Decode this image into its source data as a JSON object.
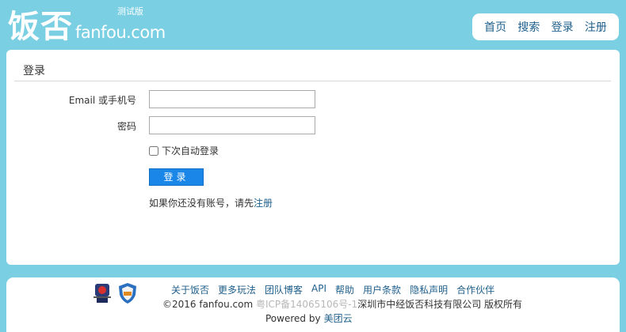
{
  "header": {
    "logo_cn": "饭否",
    "logo_en": "fanfou.com",
    "logo_beta": "测试版",
    "nav": [
      "首页",
      "搜索",
      "登录",
      "注册"
    ]
  },
  "login": {
    "title": "登录",
    "email_label": "Email 或手机号",
    "email_value": "",
    "password_label": "密码",
    "password_value": "",
    "remember_label": "下次自动登录",
    "remember_checked": false,
    "submit_label": "登录",
    "register_prefix": "如果你还没有账号，请先",
    "register_link": "注册"
  },
  "footer": {
    "links": [
      "关于饭否",
      "更多玩法",
      "团队博客",
      "API",
      "帮助",
      "用户条款",
      "隐私声明",
      "合作伙伴"
    ],
    "copyright_prefix": "©2016 fanfou.com",
    "icp": "粤ICP备14065106号-1",
    "company": "深圳市中经饭否科技有限公司 版权所有",
    "powered_label": "Powered by",
    "powered_link": "美团云"
  },
  "colors": {
    "background": "#7acfe3",
    "link": "#1f5f8b",
    "button": "#1a86e8"
  }
}
